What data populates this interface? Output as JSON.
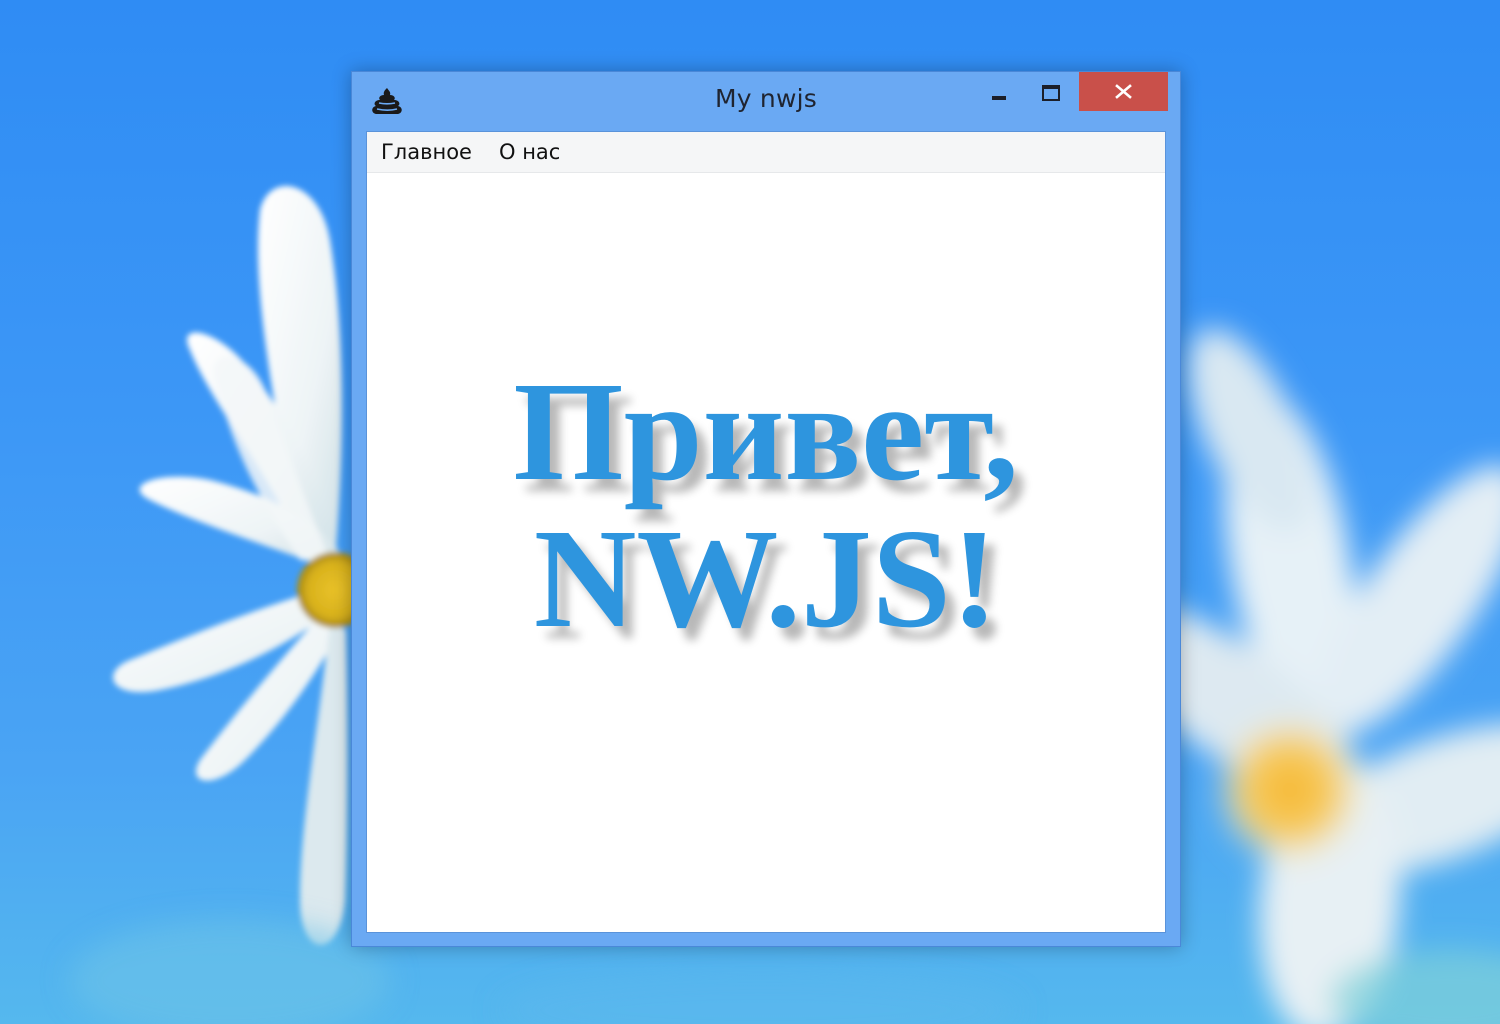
{
  "window": {
    "title": "My nwjs",
    "app_icon": "poop-icon",
    "controls": {
      "minimize_icon": "minimize-icon",
      "maximize_icon": "maximize-icon",
      "close_icon": "close-icon"
    }
  },
  "menu": {
    "items": [
      {
        "label": "Главное"
      },
      {
        "label": "О нас"
      }
    ]
  },
  "content": {
    "heading_line1": "Привет,",
    "heading_line2": "NW.JS!"
  },
  "colors": {
    "titlebar": "#6aa9f3",
    "close_button": "#c9504a",
    "heading_text": "#2e95de",
    "desktop_background": "#3c97f6"
  }
}
